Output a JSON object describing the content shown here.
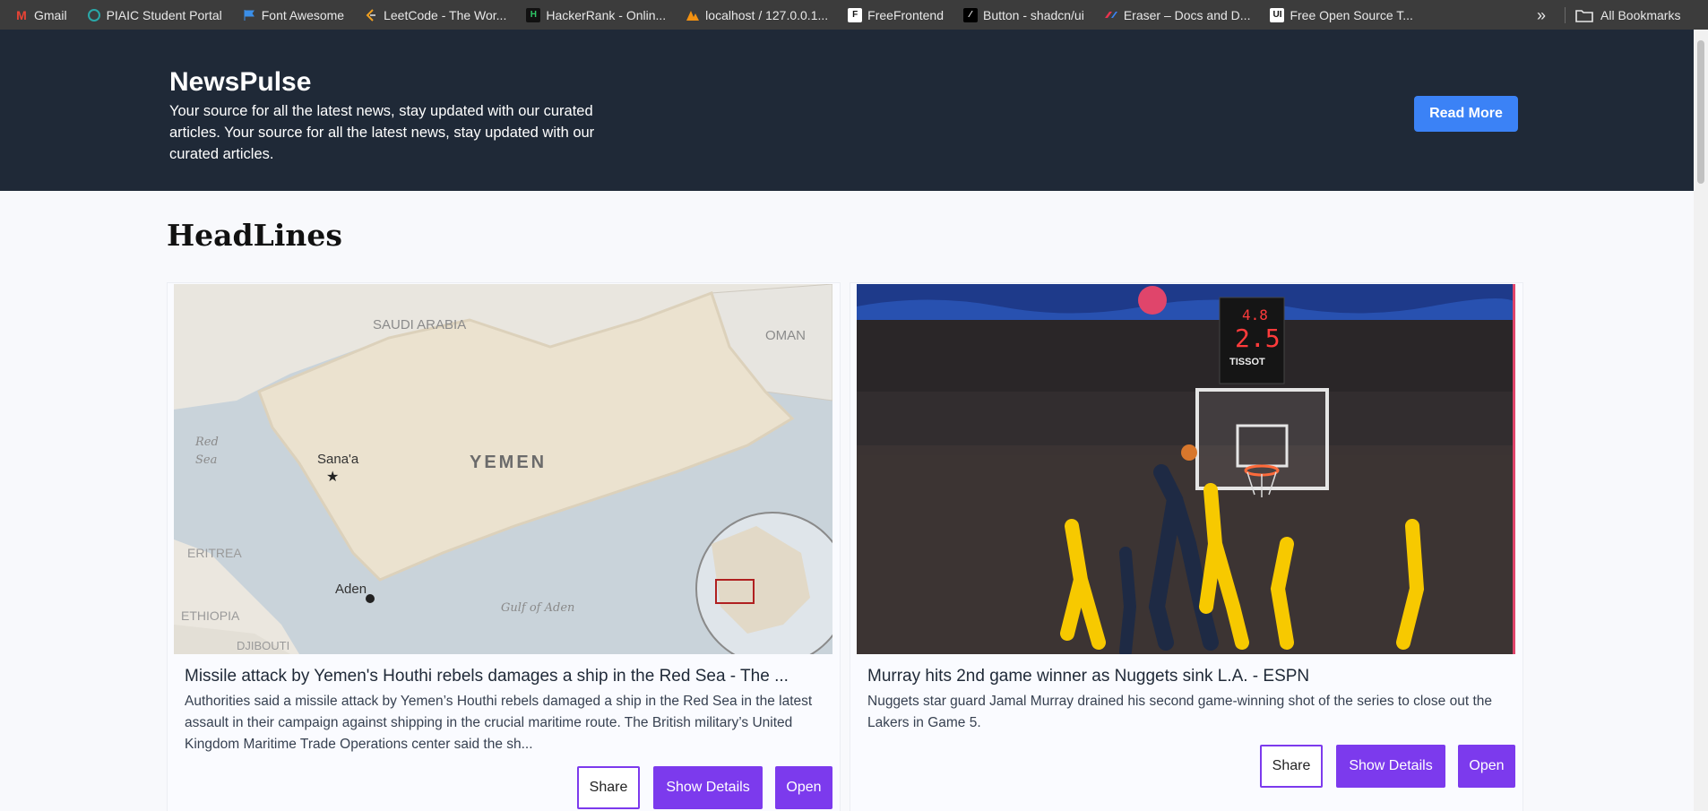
{
  "bookmarks": {
    "items": [
      {
        "label": "Gmail",
        "icon": "gmail-icon"
      },
      {
        "label": "PIAIC Student Portal",
        "icon": "piaic-icon"
      },
      {
        "label": "Font Awesome",
        "icon": "flag-icon"
      },
      {
        "label": "LeetCode - The Wor...",
        "icon": "leetcode-icon"
      },
      {
        "label": "HackerRank - Onlin...",
        "icon": "hackerrank-icon"
      },
      {
        "label": "localhost / 127.0.0.1...",
        "icon": "phpmyadmin-icon"
      },
      {
        "label": "FreeFrontend",
        "icon": "freefrontend-icon"
      },
      {
        "label": "Button - shadcn/ui",
        "icon": "shadcn-icon"
      },
      {
        "label": "Eraser – Docs and D...",
        "icon": "eraser-icon"
      },
      {
        "label": "Free Open Source T...",
        "icon": "ui-icon"
      }
    ],
    "more": "»",
    "all_label": "All Bookmarks"
  },
  "header": {
    "brand": "NewsPulse",
    "tagline": "Your source for all the latest news, stay updated with our curated articles. Your source for all the latest news, stay updated with our curated articles.",
    "cta_label": "Read More"
  },
  "main": {
    "section_title": "HeadLines",
    "cards": [
      {
        "title": "Missile attack by Yemen's Houthi rebels damages a ship in the Red Sea - The ...",
        "description": "Authorities said a missile attack by Yemen’s Houthi rebels damaged a ship in the Red Sea in the latest assault in their campaign against shipping in the crucial maritime route. The British military’s United Kingdom Maritime Trade Operations center said the sh...",
        "image_labels": {
          "saudi": "SAUDI ARABIA",
          "oman": "OMAN",
          "yemen": "YEMEN",
          "sanaa": "Sana'a",
          "aden": "Aden",
          "redsea1": "Red",
          "redsea2": "Sea",
          "eritrea": "ERITREA",
          "ethiopia": "ETHIOPIA",
          "djibouti": "DJIBOUTI",
          "gulf": "Gulf of Aden"
        },
        "share_label": "Share",
        "details_label": "Show Details",
        "open_label": "Open"
      },
      {
        "title": "Murray hits 2nd game winner as Nuggets sink L.A. - ESPN",
        "description": "Nuggets star guard Jamal Murray drained his second game-winning shot of the series to close out the Lakers in Game 5.",
        "image_labels": {
          "clock_top": "4.8",
          "clock_main": "2.5",
          "sponsor": "TISSOT"
        },
        "share_label": "Share",
        "details_label": "Show Details",
        "open_label": "Open"
      }
    ]
  },
  "colors": {
    "header_bg": "#1f2937",
    "accent_blue": "#3b82f6",
    "accent_purple": "#7c3aed"
  }
}
